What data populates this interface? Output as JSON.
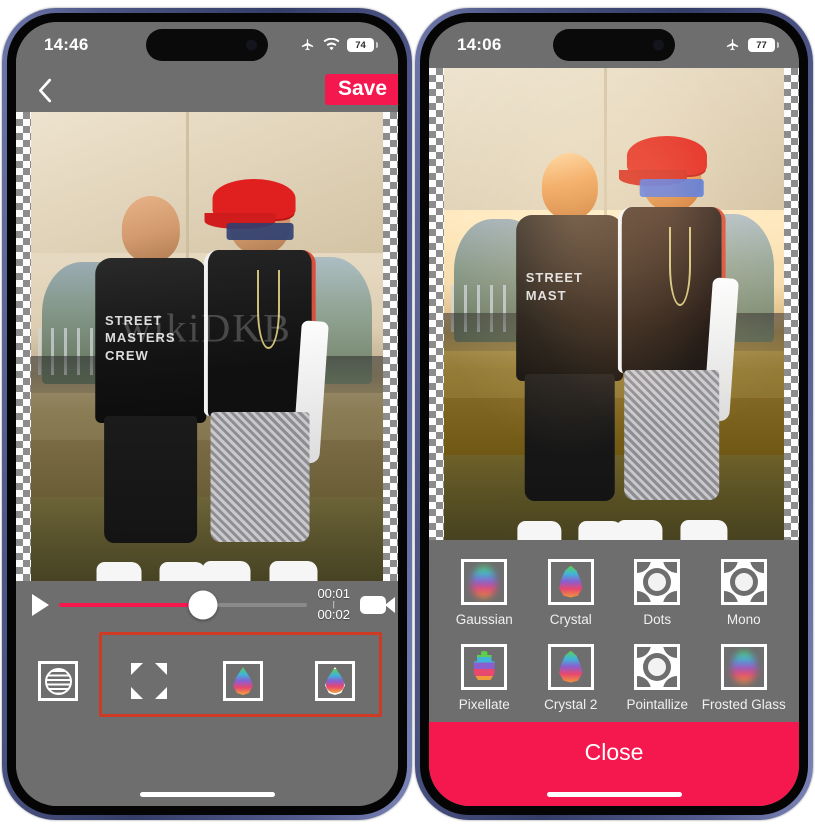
{
  "left_phone": {
    "status": {
      "time": "14:46",
      "airplane_icon": "airplane-icon",
      "wifi_icon": "wifi-icon",
      "battery": "74"
    },
    "nav": {
      "back_icon": "chevron-left-icon",
      "save_label": "Save"
    },
    "player": {
      "play_icon": "play-icon",
      "current_time": "00:01",
      "separator": "|",
      "total_time": "00:02",
      "camera_icon": "video-camera-icon",
      "progress_percent": 58
    },
    "toolbar": {
      "items": [
        {
          "name": "stripes-circle-icon",
          "label": ""
        },
        {
          "name": "expand-arrows-icon",
          "label": ""
        },
        {
          "name": "color-drop-icon",
          "label": ""
        },
        {
          "name": "outline-drop-icon",
          "label": ""
        }
      ],
      "highlight_color": "#cf3a25"
    },
    "photo": {
      "shirt_text": "STREET\nMASTERS\nCREW",
      "watermark": "wikiDKB"
    }
  },
  "right_phone": {
    "status": {
      "time": "14:06",
      "airplane_icon": "airplane-icon",
      "battery": "77"
    },
    "filters": [
      {
        "label": "Gaussian",
        "icon": "gaussian-blur-icon"
      },
      {
        "label": "Crystal",
        "icon": "crystal-icon"
      },
      {
        "label": "Dots",
        "icon": "dots-icon"
      },
      {
        "label": "Mono",
        "icon": "mono-icon"
      },
      {
        "label": "Pixellate",
        "icon": "pixellate-icon"
      },
      {
        "label": "Crystal 2",
        "icon": "crystal2-icon"
      },
      {
        "label": "Pointallize",
        "icon": "pointallize-icon"
      },
      {
        "label": "Frosted Glass",
        "icon": "frosted-glass-icon"
      }
    ],
    "close_label": "Close",
    "close_color": "#f5184f",
    "photo": {
      "shirt_text": "STREET\nMAST",
      "watermark": ""
    }
  },
  "theme": {
    "accent": "#f5184f",
    "screen_bg": "#6e6e6e",
    "frame": "#454d7c"
  }
}
